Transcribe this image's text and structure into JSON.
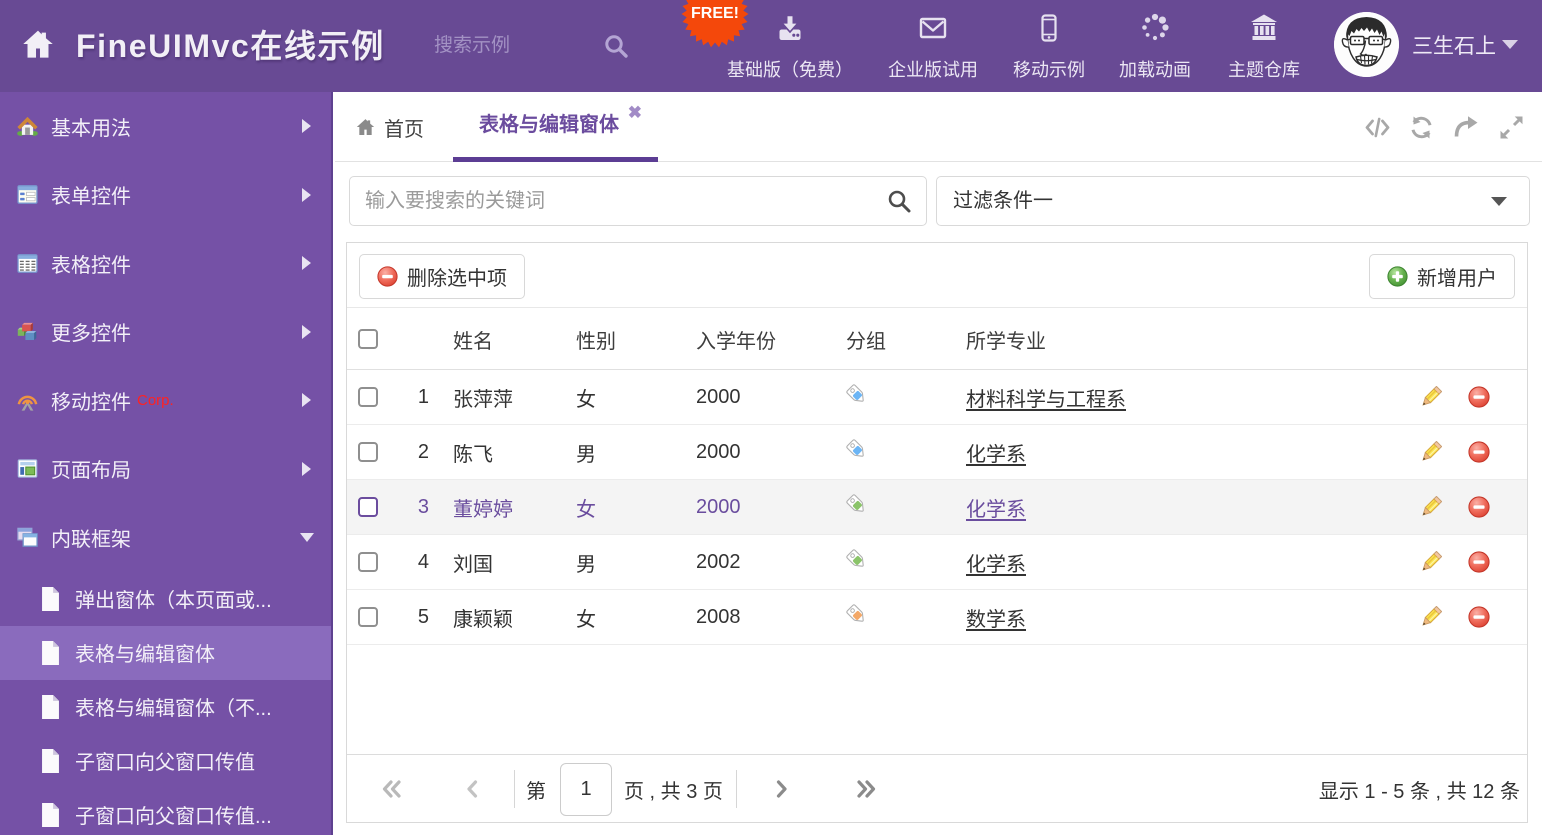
{
  "header": {
    "title": "FineUIMvc在线示例",
    "search_placeholder": "搜索示例",
    "free_badge": "FREE!",
    "nav": [
      {
        "icon": "download-icon",
        "label": "基础版（免费）"
      },
      {
        "icon": "envelope-icon",
        "label": "企业版试用"
      },
      {
        "icon": "mobile-icon",
        "label": "移动示例"
      },
      {
        "icon": "spinner-icon",
        "label": "加载动画"
      },
      {
        "icon": "bank-icon",
        "label": "主题仓库"
      }
    ],
    "username": "三生石上"
  },
  "sidebar": {
    "items": [
      {
        "label": "基本用法"
      },
      {
        "label": "表单控件"
      },
      {
        "label": "表格控件"
      },
      {
        "label": "更多控件"
      },
      {
        "label": "移动控件",
        "badge": "Corp."
      },
      {
        "label": "页面布局"
      },
      {
        "label": "内联框架"
      }
    ],
    "subitems": [
      {
        "label": "弹出窗体（本页面或..."
      },
      {
        "label": "表格与编辑窗体"
      },
      {
        "label": "表格与编辑窗体（不..."
      },
      {
        "label": "子窗口向父窗口传值"
      },
      {
        "label": "子窗口向父窗口传值..."
      }
    ]
  },
  "tabs": {
    "home": "首页",
    "active": "表格与编辑窗体"
  },
  "filter": {
    "search_placeholder": "输入要搜索的关键词",
    "dropdown_value": "过滤条件一"
  },
  "toolbar": {
    "delete_label": "删除选中项",
    "add_label": "新增用户"
  },
  "table": {
    "columns": {
      "name": "姓名",
      "gender": "性别",
      "year": "入学年份",
      "group": "分组",
      "major": "所学专业"
    },
    "rows": [
      {
        "index": "1",
        "name": "张萍萍",
        "gender": "女",
        "year": "2000",
        "tag": "blue",
        "major": "材料科学与工程系"
      },
      {
        "index": "2",
        "name": "陈飞",
        "gender": "男",
        "year": "2000",
        "tag": "blue",
        "major": "化学系"
      },
      {
        "index": "3",
        "name": "董婷婷",
        "gender": "女",
        "year": "2000",
        "tag": "green",
        "major": "化学系"
      },
      {
        "index": "4",
        "name": "刘国",
        "gender": "男",
        "year": "2002",
        "tag": "green",
        "major": "化学系"
      },
      {
        "index": "5",
        "name": "康颖颖",
        "gender": "女",
        "year": "2008",
        "tag": "orange",
        "major": "数学系"
      }
    ]
  },
  "pager": {
    "word_page_prefix": "第",
    "page": "1",
    "word_page_suffix": "页 , 共 3 页",
    "status": "显示 1 - 5 条 , 共 12 条"
  },
  "colors": {
    "header_bg": "#684a94",
    "sidebar_bg": "#7551a6",
    "accent": "#5c3d94",
    "badge_orange": "#f4480b",
    "selected_row_text": "#6a4d9e"
  }
}
